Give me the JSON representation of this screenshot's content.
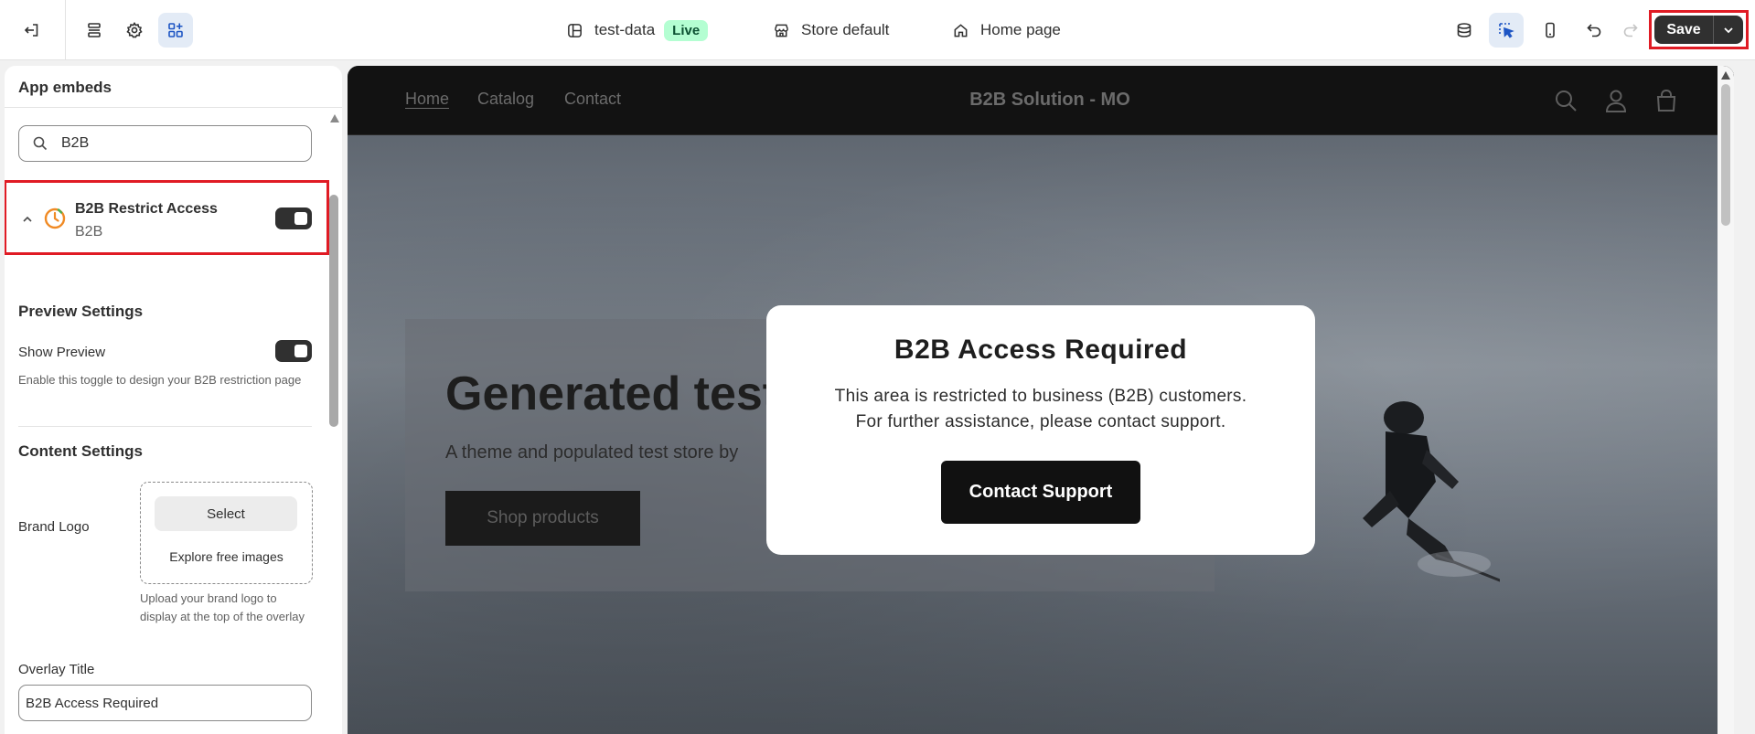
{
  "topbar": {
    "store_name": "test-data",
    "status_badge": "Live",
    "store_selector": "Store default",
    "page_selector": "Home page",
    "save_label": "Save"
  },
  "sidebar": {
    "title": "App embeds",
    "search": {
      "value": "B2B",
      "placeholder": ""
    },
    "app_item": {
      "title": "B2B Restrict Access",
      "subtitle": "B2B",
      "enabled": true
    },
    "preview_settings": {
      "title": "Preview Settings",
      "show_preview_label": "Show Preview",
      "show_preview_enabled": true,
      "show_preview_help": "Enable this toggle to design your B2B restriction page"
    },
    "content_settings": {
      "title": "Content Settings",
      "brand_logo_label": "Brand Logo",
      "select_label": "Select",
      "explore_label": "Explore free images",
      "brand_logo_help": "Upload your brand logo to display at the top of the overlay",
      "overlay_title_label": "Overlay Title",
      "overlay_title_value": "B2B Access Required"
    }
  },
  "preview": {
    "nav": {
      "home": "Home",
      "catalog": "Catalog",
      "contact": "Contact"
    },
    "store_title": "B2B Solution - MO",
    "hero": {
      "title": "Generated test",
      "subtitle": "A theme and populated test store by",
      "button": "Shop products"
    },
    "modal": {
      "title": "B2B Access Required",
      "text_line1": "This area is restricted to business (B2B) customers.",
      "text_line2": "For further assistance, please contact support.",
      "button": "Contact Support"
    }
  },
  "colors": {
    "highlight": "#e01b24",
    "live_badge_bg": "#b4fed2",
    "primary_dark": "#303030"
  }
}
